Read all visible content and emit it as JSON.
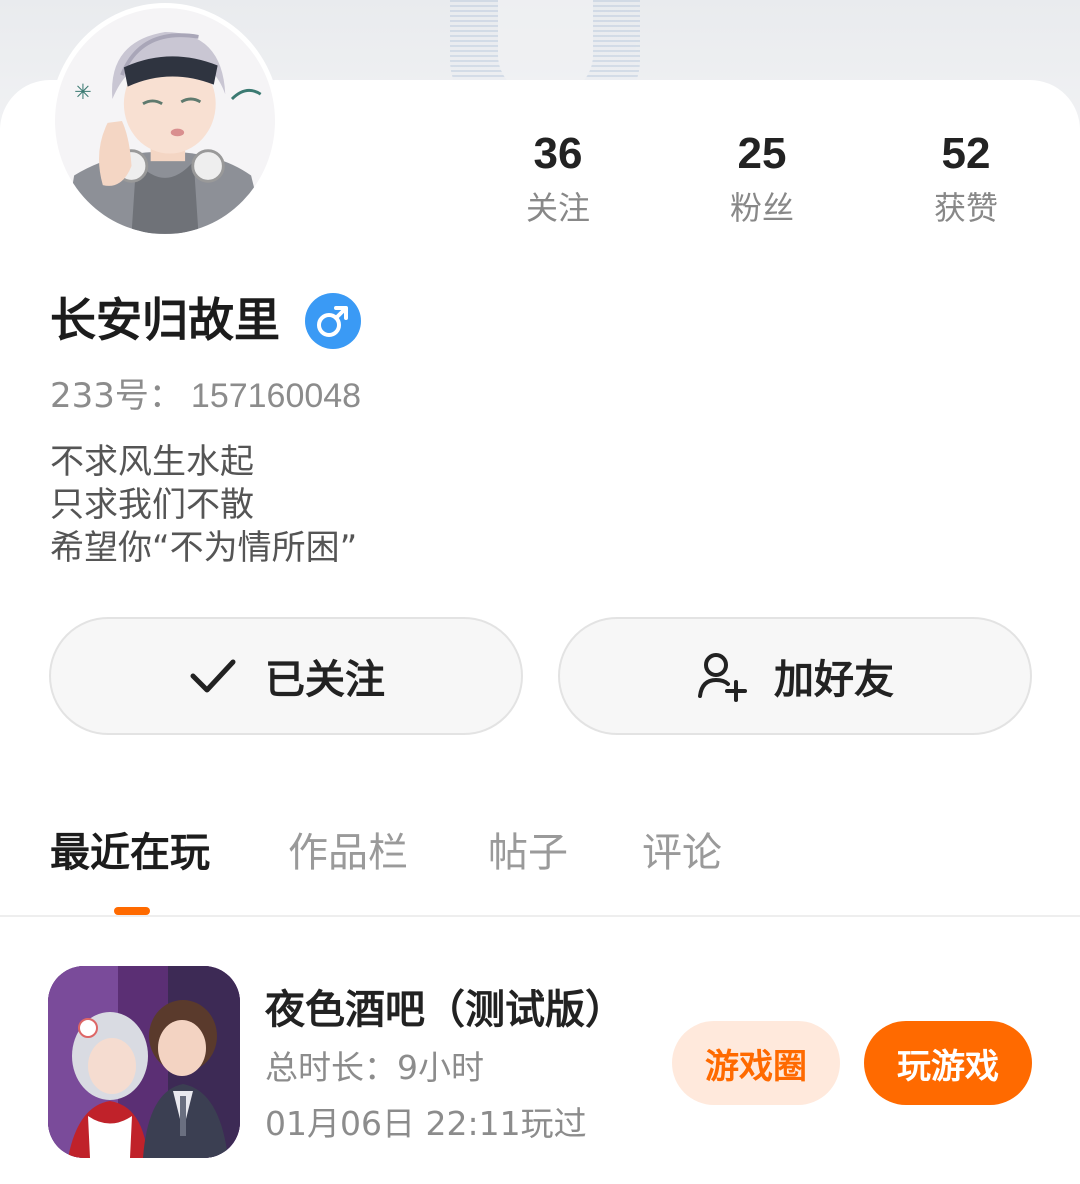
{
  "profile": {
    "name": "长安归故里",
    "gender_icon": "male-icon",
    "uid_label": "233号：",
    "uid_value": "157160048",
    "bio": [
      "不求风生水起",
      "只求我们不散",
      "希望你“不为情所困”"
    ]
  },
  "stats": {
    "following": {
      "value": "36",
      "label": "关注"
    },
    "fans": {
      "value": "25",
      "label": "粉丝"
    },
    "likes": {
      "value": "52",
      "label": "获赞"
    }
  },
  "actions": {
    "followed_label": "已关注",
    "followed_icon": "checkmark-icon",
    "add_friend_label": "加好友",
    "add_friend_icon": "add-user-icon"
  },
  "tabs": [
    {
      "label": "最近在玩",
      "active": true
    },
    {
      "label": "作品栏",
      "active": false
    },
    {
      "label": "帖子",
      "active": false
    },
    {
      "label": "评论",
      "active": false
    }
  ],
  "recent_games": [
    {
      "title": "夜色酒吧（测试版）",
      "playtime": "总时长：9小时",
      "last_played": "01月06日 22:11玩过",
      "circle_button": "游戏圈",
      "play_button": "玩游戏"
    }
  ],
  "colors": {
    "accent": "#ff6a00",
    "accent_light": "#ffe9dc",
    "gender_badge": "#3a9af5"
  }
}
